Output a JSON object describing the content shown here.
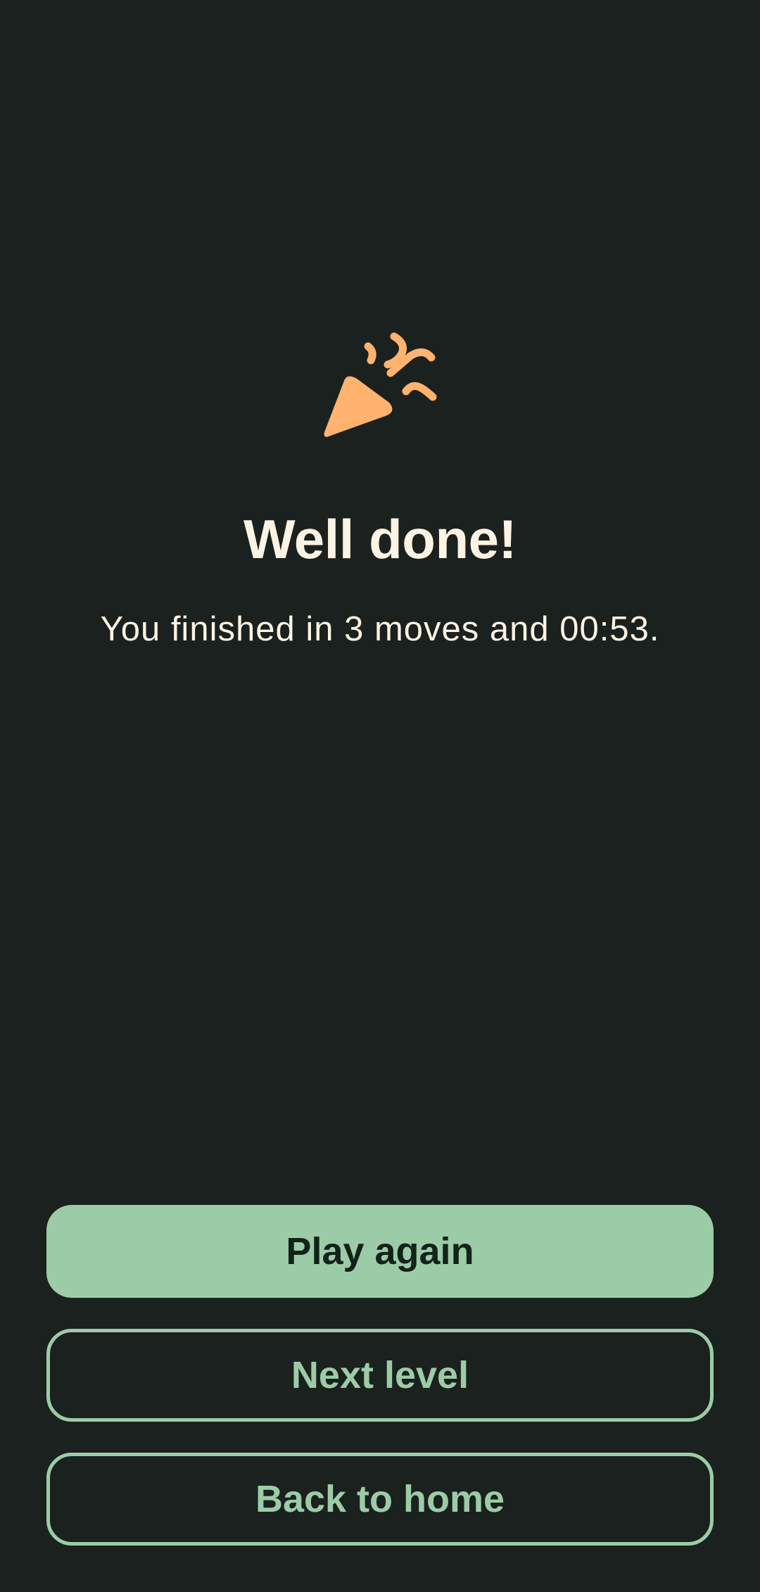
{
  "colors": {
    "background": "#1b211e",
    "accent": "#9ccca7",
    "icon": "#ffb36e",
    "text": "#fbf3e3"
  },
  "result": {
    "icon": "party-popper-icon",
    "title": "Well done!",
    "summary": "You finished in 3 moves and 00:53."
  },
  "actions": {
    "play_again": "Play again",
    "next_level": "Next level",
    "back_home": "Back to home"
  }
}
